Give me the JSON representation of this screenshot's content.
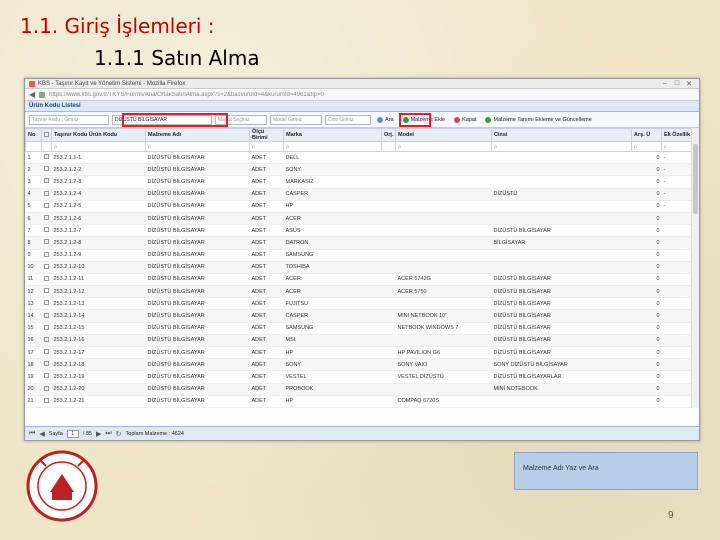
{
  "slide": {
    "title": "1.1. Giriş İşlemleri :",
    "subtitle": "1.1.1 Satın Alma",
    "caption": "Malzeme Adı Yaz ve Ara",
    "page_number": "9"
  },
  "browser": {
    "tab_title": "KBS - Taşınır Kayıt ve Yönetim Sistemi - Mozilla Firefox",
    "url": "https://www.kbs.gov.tr/TKYS/Forms/Ana/OrtakSatınAlma.aspx?s=2&basvuruId=4&kurumId=4961&tip=0",
    "win_controls": [
      "–",
      "□",
      "✕"
    ]
  },
  "panel": {
    "title": "Ürün Kodu Listesi"
  },
  "toolbar": {
    "tasinir_kodu_placeholder": "Taşınır Kodu : Giriniz",
    "malzeme_adi_value": "DİZÜSTÜ BİLGİSAYAR",
    "marka_placeholder": "Marka Seçiniz",
    "model_placeholder": "Model Giriniz",
    "cins_placeholder": "Cins Giriniz",
    "ara_label": "Ara",
    "malzeme_ekle_label": "Malzeme Ekle",
    "kapat_label": "Kapat",
    "talep_label": "Malzeme Tanımı Ekleme ve Güncelleme"
  },
  "table": {
    "headers": [
      "No",
      "",
      "Taşınır Kodu",
      "Ürün Kodu",
      "Malzeme Adı",
      "Ölçü Birimi",
      "Marka",
      "Orj.",
      "Model",
      "Cinsi",
      "Arş. Ü",
      "Ek Özellik"
    ],
    "rows": [
      [
        "1",
        "253.2.1.1-1",
        "DİZÜSTÜ BİLGİSAYAR",
        "ADET",
        "DELL",
        "",
        "",
        "0",
        "-"
      ],
      [
        "2",
        "253.2.1.2-2",
        "DİZÜSTÜ BİLGİSAYAR",
        "ADET",
        "SONY",
        "",
        "",
        "0",
        "-"
      ],
      [
        "3",
        "253.2.1.2-3",
        "DİZÜSTÜ BİLGİSAYAR",
        "ADET",
        "MARKASIZ",
        "",
        "",
        "0",
        "-"
      ],
      [
        "4",
        "253.2.1.2-4",
        "DİZÜSTÜ BİLGİSAYAR",
        "ADET",
        "CASPER",
        "",
        "DİZÜSTÜ",
        "0",
        "-"
      ],
      [
        "5",
        "253.2.1.2-5",
        "DİZÜSTÜ BİLGİSAYAR",
        "ADET",
        "HP",
        "",
        "",
        "0",
        "-"
      ],
      [
        "6",
        "253.2.1.2-6",
        "DİZÜSTÜ BİLGİSAYAR",
        "ADET",
        "ACER",
        "",
        "",
        "0",
        ""
      ],
      [
        "7",
        "253.2.1.2-7",
        "DİZÜSTÜ BİLGİSAYAR",
        "ADET",
        "ASUS",
        "",
        "DİZÜSTÜ BİLGİSAYAR",
        "0",
        ""
      ],
      [
        "8",
        "253.2.1.2-8",
        "DİZÜSTÜ BİLGİSAYAR",
        "ADET",
        "DATRON",
        "",
        "BİLGİSAYAR",
        "0",
        ""
      ],
      [
        "9",
        "253.2.1.2-9",
        "DİZÜSTÜ BİLGİSAYAR",
        "ADET",
        "SAMSUNG",
        "",
        "",
        "0",
        ""
      ],
      [
        "10",
        "253.2.1.2-10",
        "DİZÜSTÜ BİLGİSAYAR",
        "ADET",
        "TOSHIBA",
        "",
        "",
        "0",
        ""
      ],
      [
        "11",
        "253.2.1.2-11",
        "DİZÜSTÜ BİLGİSAYAR",
        "ADET",
        "ACER",
        "ACER 5742G",
        "DİZÜSTÜ BİLGİSAYAR",
        "0",
        ""
      ],
      [
        "12",
        "253.2.1.2-12",
        "DİZÜSTÜ BİLGİSAYAR",
        "ADET",
        "ACER",
        "ACER 5750",
        "DİZÜSTÜ BİLGİSAYAR",
        "0",
        ""
      ],
      [
        "13",
        "253.2.1.2-13",
        "DİZÜSTÜ BİLGİSAYAR",
        "ADET",
        "FUJITSU",
        "",
        "DİZÜSTÜ BİLGİSAYAR",
        "0",
        ""
      ],
      [
        "14",
        "253.2.1.2-14",
        "DİZÜSTÜ BİLGİSAYAR",
        "ADET",
        "CASPER",
        "MINI NETBOOK 10\"",
        "DİZÜSTÜ BİLGİSAYAR",
        "0",
        ""
      ],
      [
        "15",
        "253.2.1.2-15",
        "DİZÜSTÜ BİLGİSAYAR",
        "ADET",
        "SAMSUNG",
        "NETBOOK WİNDOWS 7",
        "DİZÜSTÜ BİLGİSAYAR",
        "0",
        ""
      ],
      [
        "16",
        "253.2.1.2-16",
        "DİZÜSTÜ BİLGİSAYAR",
        "ADET",
        "MSI",
        "",
        "DİZÜSTÜ BİLGİSAYAR",
        "0",
        ""
      ],
      [
        "17",
        "253.2.1.2-17",
        "DİZÜSTÜ BİLGİSAYAR",
        "ADET",
        "HP",
        "HP PAVILION G6",
        "DİZÜSTÜ BİLGİSAYAR",
        "0",
        ""
      ],
      [
        "18",
        "253.2.1.2-18",
        "DİZÜSTÜ BİLGİSAYAR",
        "ADET",
        "SONY",
        "SONY VAIO",
        "SONY DİZÜSTÜ BİLGİSAYAR",
        "0",
        ""
      ],
      [
        "19",
        "253.2.1.2-19",
        "DİZÜSTÜ BİLGİSAYAR",
        "ADET",
        "VESTEL",
        "VESTEL DİZÜSTÜ",
        "DİZÜSTÜ BİLGİSAYARLAR",
        "0",
        ""
      ],
      [
        "20",
        "253.2.1.2-20",
        "DİZÜSTÜ BİLGİSAYAR",
        "ADET",
        "PROBOOK",
        "",
        "MİNİ NOTEBOOK",
        "0",
        ""
      ],
      [
        "21",
        "253.2.1.2-21",
        "DİZÜSTÜ BİLGİSAYAR",
        "ADET",
        "HP",
        "COMPAQ 6720S",
        "",
        "0",
        ""
      ]
    ]
  },
  "pager": {
    "page_label": "Sayfa",
    "page_value": "1",
    "of_label": "/ 85",
    "total_label": "Toplam Malzeme : 4624"
  },
  "logo": {
    "text": "MİLLİ EĞİTİM MÜDÜRLÜĞÜ · ANKARA · 1924"
  },
  "colors": {
    "highlight": "#e0202a",
    "title": "#c00000",
    "caption_bg": "#b8cde8"
  }
}
